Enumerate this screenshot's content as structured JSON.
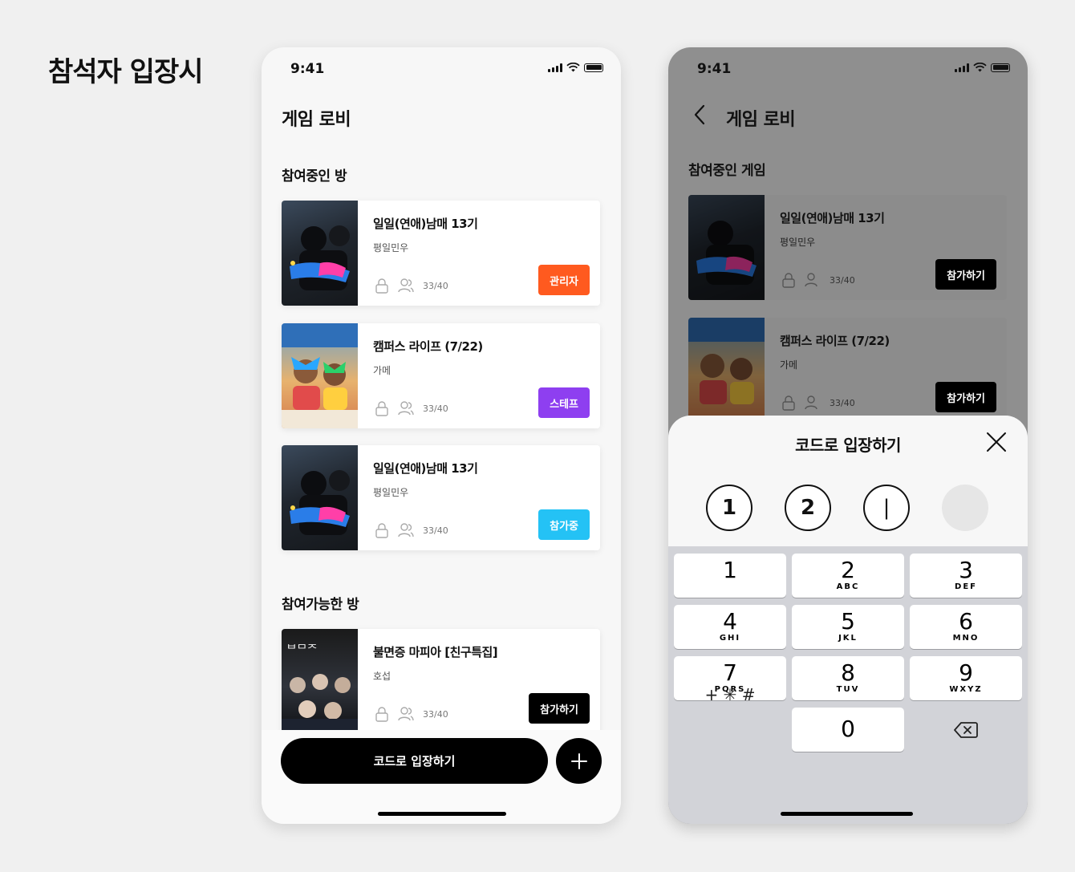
{
  "page": {
    "title": "참석자 입장시"
  },
  "left_phone": {
    "status": {
      "time": "9:41"
    },
    "nav": {
      "title": "게임 로비"
    },
    "joined_section_title": "참여중인 방",
    "joined_rooms": [
      {
        "name": "일일(연애)남매 13기",
        "host": "평일민우",
        "count": "33/40",
        "tag": "관리자",
        "tag_color": "#ff5a1f"
      },
      {
        "name": "캠퍼스 라이프 (7/22)",
        "host": "가메",
        "count": "33/40",
        "tag": "스테프",
        "tag_color": "#8e3ff0"
      },
      {
        "name": "일일(연애)남매 13기",
        "host": "평일민우",
        "count": "33/40",
        "tag": "참가중",
        "tag_color": "#24c2f5"
      }
    ],
    "available_section_title": "참여가능한 방",
    "available_rooms": [
      {
        "name": "불면증 마피아 [친구특집]",
        "host": "호섭",
        "count": "33/40",
        "tag": "참가하기",
        "tag_color": "#000000"
      }
    ],
    "enter_code_button": "코드로 입장하기"
  },
  "right_phone": {
    "status": {
      "time": "9:41"
    },
    "nav": {
      "title": "게임 로비"
    },
    "section_title": "참여중인 게임",
    "rooms": [
      {
        "name": "일일(연애)남매 13기",
        "host": "평일민우",
        "count": "33/40",
        "tag": "참가하기"
      },
      {
        "name": "캠퍼스 라이프 (7/22)",
        "host": "가메",
        "count": "33/40",
        "tag": "참가하기"
      }
    ],
    "sheet": {
      "title": "코드로 입장하기",
      "code_digits": [
        "1",
        "2",
        "|",
        ""
      ]
    },
    "keypad": [
      {
        "num": "1",
        "letters": ""
      },
      {
        "num": "2",
        "letters": "ABC"
      },
      {
        "num": "3",
        "letters": "DEF"
      },
      {
        "num": "4",
        "letters": "GHI"
      },
      {
        "num": "5",
        "letters": "JKL"
      },
      {
        "num": "6",
        "letters": "MNO"
      },
      {
        "num": "7",
        "letters": "PQRS"
      },
      {
        "num": "8",
        "letters": "TUV"
      },
      {
        "num": "9",
        "letters": "WXYZ"
      }
    ],
    "keypad_symbols": "+ ✳ #",
    "keypad_zero": "0"
  }
}
